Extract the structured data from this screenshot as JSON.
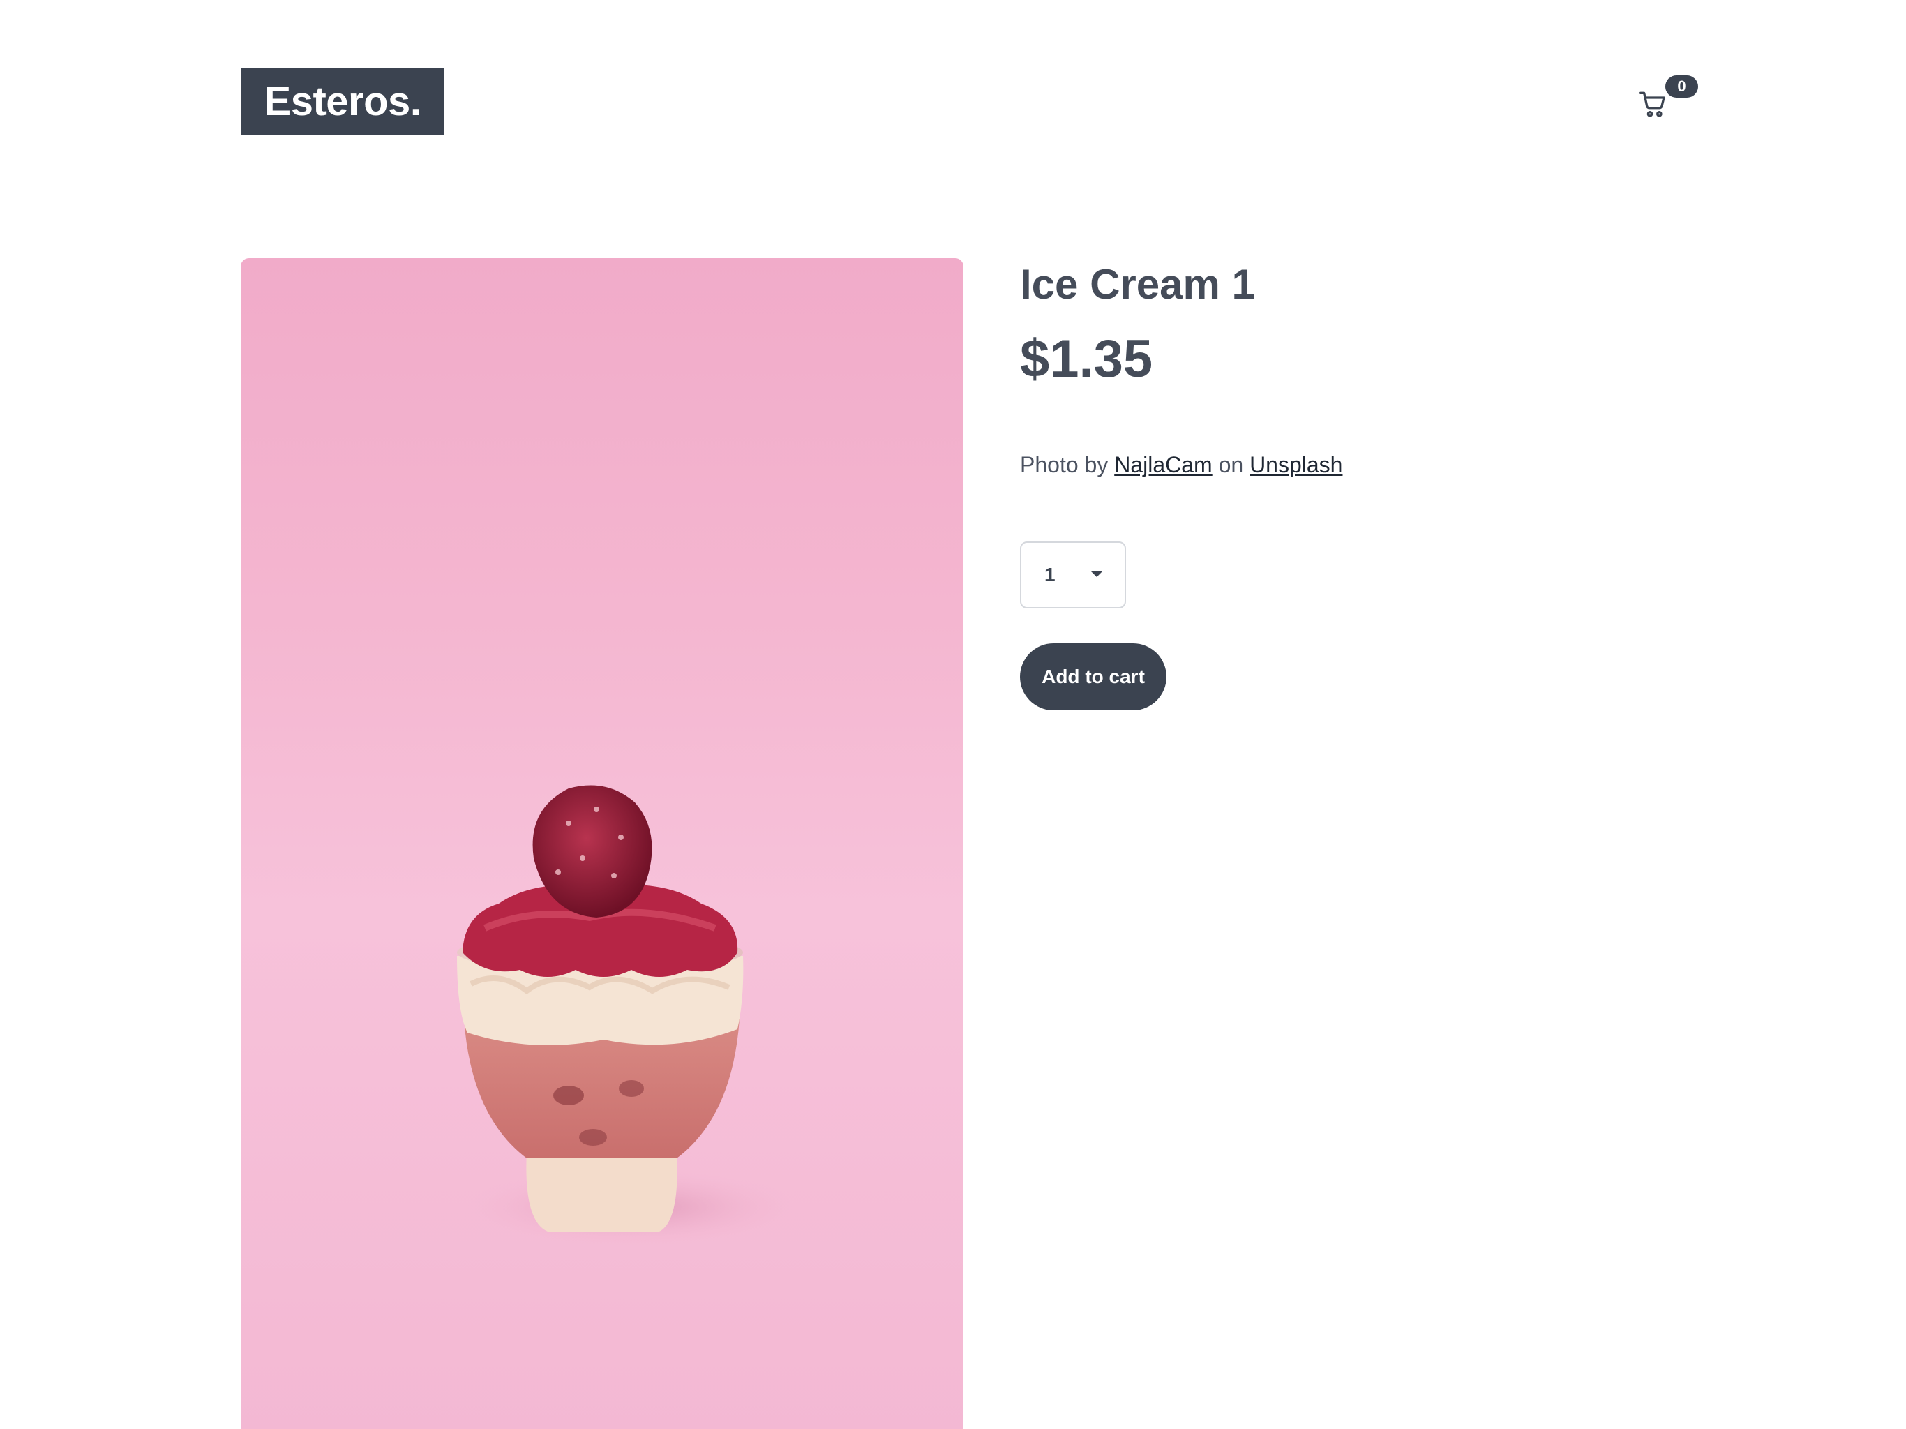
{
  "header": {
    "logo": "Esteros.",
    "cart_count": "0",
    "cart_icon": "shopping-cart-icon"
  },
  "product": {
    "title": "Ice Cream 1",
    "price": "$1.35",
    "credit": {
      "prefix": "Photo by",
      "author": "NajlaCam",
      "middle": "on",
      "site": "Unsplash"
    },
    "quantity": "1",
    "add_to_cart_label": "Add to cart",
    "image_subject": "strawberry-dessert-cup-on-pink-background"
  },
  "colors": {
    "primary": "#3b4350",
    "image_bg": "#f4b6d0"
  }
}
